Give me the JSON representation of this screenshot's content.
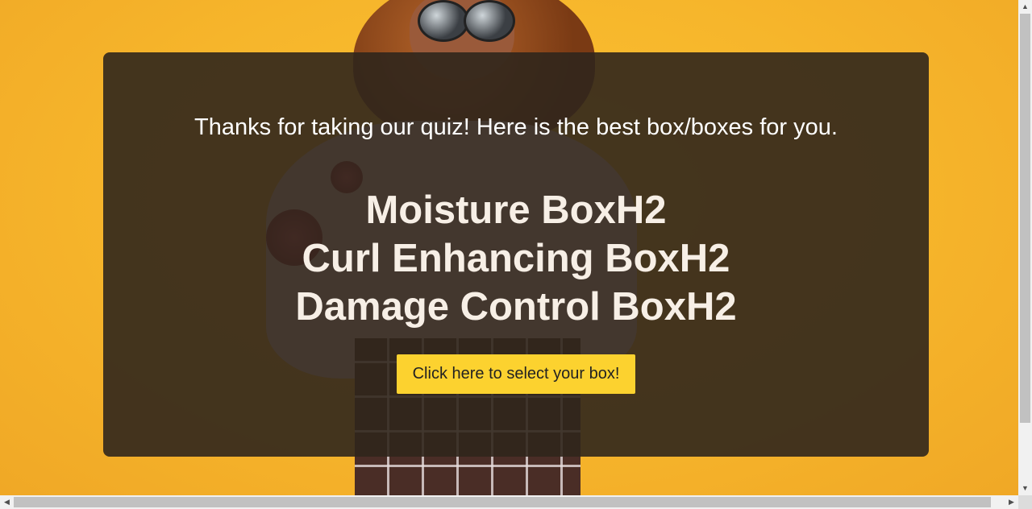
{
  "quiz_result": {
    "message": "Thanks for taking our quiz! Here is the best box/boxes for you.",
    "boxes": [
      "Moisture BoxH2",
      "Curl Enhancing BoxH2",
      "Damage Control BoxH2"
    ],
    "select_button_label": "Click here to select your box!"
  },
  "scrollbars": {
    "up_icon": "▲",
    "down_icon": "▼",
    "left_icon": "◀",
    "right_icon": "▶"
  },
  "colors": {
    "background": "#f6b52b",
    "overlay": "#30261c",
    "button": "#fcd22f"
  }
}
